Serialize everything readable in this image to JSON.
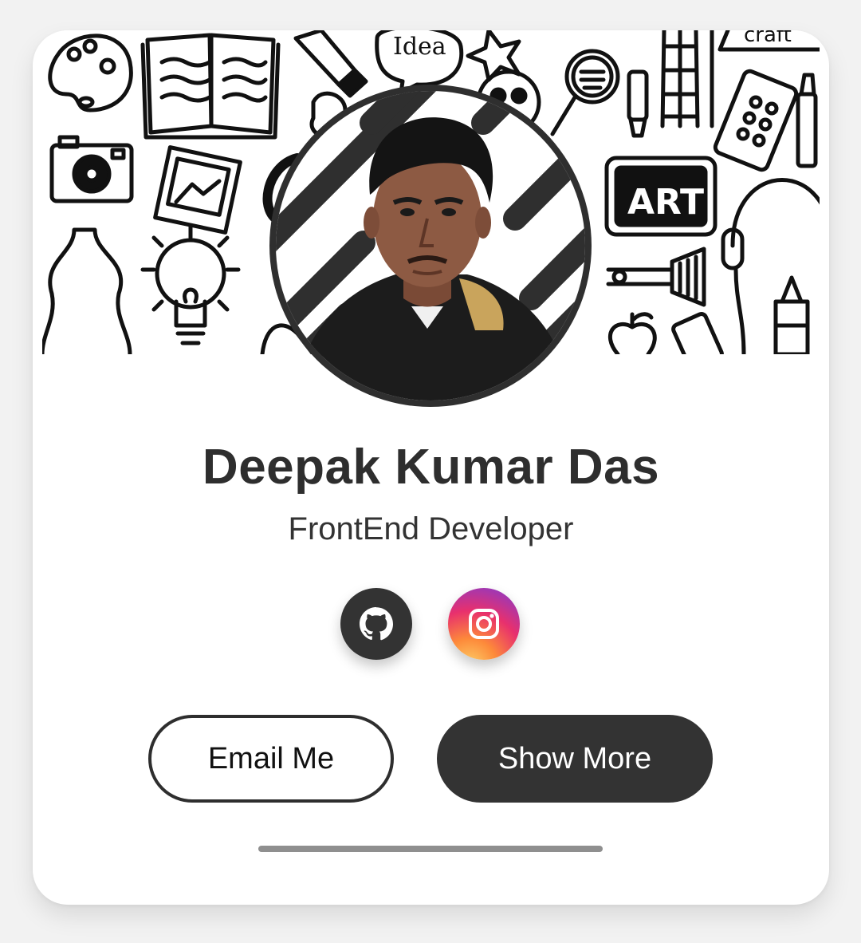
{
  "profile": {
    "name": "Deepak Kumar Das",
    "role": "FrontEnd Developer",
    "banner_words": {
      "idea": "Idea",
      "art": "ART",
      "craft": "craft"
    }
  },
  "social": [
    {
      "icon": "github-icon",
      "color": "#333333"
    },
    {
      "icon": "instagram-icon",
      "color": "gradient #fdd36a-#e8306d-#7b3bd6"
    }
  ],
  "actions": {
    "email_label": "Email Me",
    "more_label": "Show More"
  },
  "colors": {
    "card": "#ffffff",
    "background": "#f2f2f2",
    "text": "#2e2e2e",
    "button_dark": "#333333",
    "divider": "#8f8f8f"
  }
}
